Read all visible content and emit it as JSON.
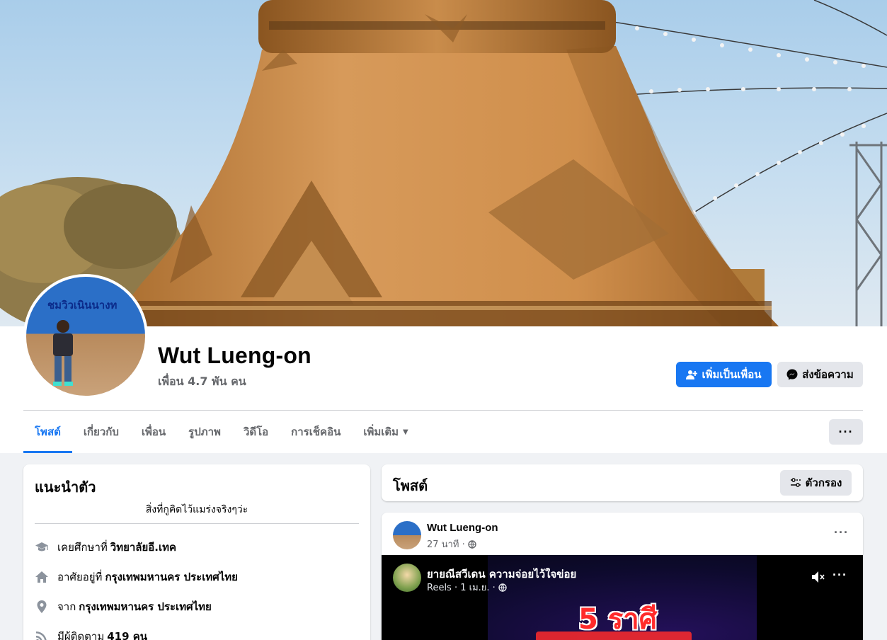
{
  "profile": {
    "name": "Wut Lueng-on",
    "friends": "เพื่อน 4.7 พัน คน",
    "avatar_sign_text": "ชมวิวเนินนางท"
  },
  "actions": {
    "add_friend": "เพิ่มเป็นเพื่อน",
    "message": "ส่งข้อความ",
    "more": "···"
  },
  "tabs": [
    {
      "label": "โพสต์",
      "active": true
    },
    {
      "label": "เกี่ยวกับ"
    },
    {
      "label": "เพื่อน"
    },
    {
      "label": "รูปภาพ"
    },
    {
      "label": "วิดีโอ"
    },
    {
      "label": "การเช็คอิน"
    },
    {
      "label": "เพิ่มเติม"
    }
  ],
  "intro": {
    "title": "แนะนำตัว",
    "bio": "สิ่งที่กูคิดไว้แมร่งจริงๆว่ะ",
    "rows": [
      {
        "prefix": "เคยศึกษาที่",
        "value": "วิทยาลัยอี.เทค",
        "icon": "graduation-cap-icon"
      },
      {
        "prefix": "อาศัยอยู่ที่",
        "value": "กรุงเทพมหานคร ประเทศไทย",
        "icon": "home-icon"
      },
      {
        "prefix": "จาก",
        "value": "กรุงเทพมหานคร ประเทศไทย",
        "icon": "location-pin-icon"
      },
      {
        "prefix": "มีผู้ติดตาม",
        "value": "419 คน",
        "icon": "rss-icon"
      }
    ]
  },
  "posts": {
    "title": "โพสต์",
    "filter": "ตัวกรอง",
    "post": {
      "author": "Wut Lueng-on",
      "time": "27 นาที ·",
      "reel": {
        "title": "ยายณีสวีเดน ความจ่อยไว้ใจข่อย",
        "meta": "Reels · 1 เม.ย. ·",
        "big_text": "5 ราศี"
      }
    }
  },
  "colors": {
    "primary": "#1877f2",
    "page_bg": "#f0f2f5",
    "secondary_btn": "#e4e6eb",
    "muted_text": "#65676b"
  }
}
